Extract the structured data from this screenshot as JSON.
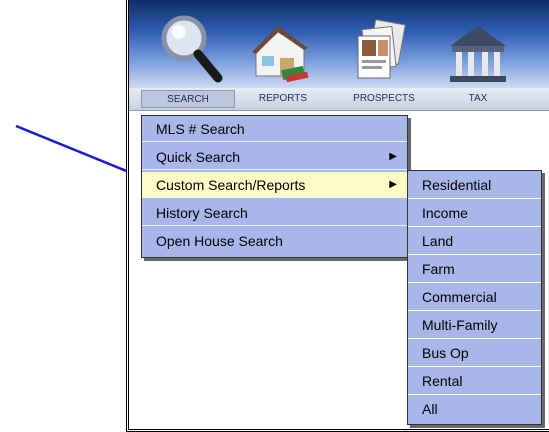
{
  "toolbar": {
    "tabs": [
      {
        "label": "SEARCH",
        "icon": "magnifier-icon",
        "active": true
      },
      {
        "label": "REPORTS",
        "icon": "house-report-icon",
        "active": false
      },
      {
        "label": "PROSPECTS",
        "icon": "contact-cards-icon",
        "active": false
      },
      {
        "label": "TAX",
        "icon": "government-building-icon",
        "active": false
      }
    ]
  },
  "search_menu": {
    "items": [
      {
        "label": "MLS # Search",
        "has_submenu": false
      },
      {
        "label": "Quick Search",
        "has_submenu": true
      },
      {
        "label": "Custom Search/Reports",
        "has_submenu": true,
        "highlighted": true
      },
      {
        "label": "History Search",
        "has_submenu": false
      },
      {
        "label": "Open House Search",
        "has_submenu": false
      }
    ],
    "arrow_glyph": "▶"
  },
  "custom_submenu": {
    "items": [
      "Residential",
      "Income",
      "Land",
      "Farm",
      "Commercial",
      "Multi-Family",
      "Bus Op",
      "Rental",
      "All"
    ]
  },
  "colors": {
    "menu_bg": "#a9b6ea",
    "highlight_bg": "#fefac6",
    "annotation_arrow": "#1b1bdc"
  }
}
